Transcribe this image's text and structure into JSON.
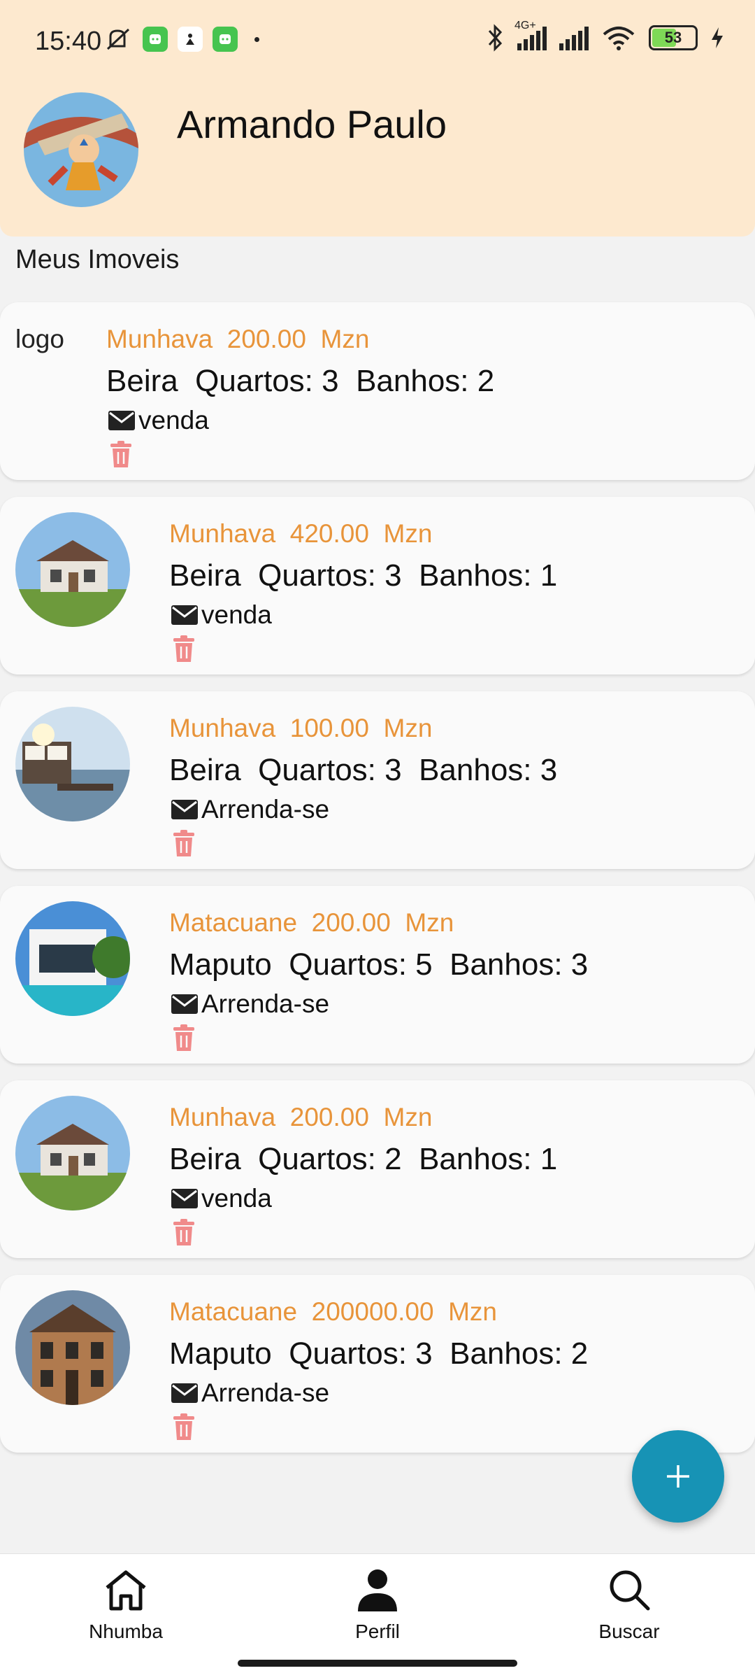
{
  "status_bar": {
    "time": "15:40",
    "battery": "53",
    "network": "4G+"
  },
  "profile": {
    "name": "Armando Paulo"
  },
  "section_title": "Meus Imoveis",
  "listings": [
    {
      "image": "logo",
      "image_alt": "logo",
      "location": "Munhava",
      "price": "200.00",
      "currency": "Mzn",
      "city": "Beira",
      "rooms_label": "Quartos: 3",
      "baths_label": "Banhos: 2",
      "type": "venda"
    },
    {
      "image": "house",
      "location": "Munhava",
      "price": "420.00",
      "currency": "Mzn",
      "city": "Beira",
      "rooms_label": "Quartos: 3",
      "baths_label": "Banhos: 1",
      "type": "venda"
    },
    {
      "image": "beach-house",
      "location": "Munhava",
      "price": "100.00",
      "currency": "Mzn",
      "city": "Beira",
      "rooms_label": "Quartos: 3",
      "baths_label": "Banhos: 3",
      "type": "Arrenda-se"
    },
    {
      "image": "modern-villa",
      "location": "Matacuane",
      "price": "200.00",
      "currency": "Mzn",
      "city": "Maputo",
      "rooms_label": "Quartos: 5",
      "baths_label": "Banhos: 3",
      "type": "Arrenda-se"
    },
    {
      "image": "house",
      "location": "Munhava",
      "price": "200.00",
      "currency": "Mzn",
      "city": "Beira",
      "rooms_label": "Quartos: 2",
      "baths_label": "Banhos: 1",
      "type": "venda"
    },
    {
      "image": "victorian-house",
      "location": "Matacuane",
      "price": "200000.00",
      "currency": "Mzn",
      "city": "Maputo",
      "rooms_label": "Quartos: 3",
      "baths_label": "Banhos: 2",
      "type": "Arrenda-se"
    }
  ],
  "nav": [
    {
      "label": "Nhumba",
      "icon": "home-icon"
    },
    {
      "label": "Perfil",
      "icon": "person-icon"
    },
    {
      "label": "Buscar",
      "icon": "search-icon"
    }
  ],
  "colors": {
    "header_bg": "#fde9cf",
    "accent_orange": "#e8943a",
    "fab_blue": "#1793b5",
    "trash_pink": "#f08a8a"
  }
}
